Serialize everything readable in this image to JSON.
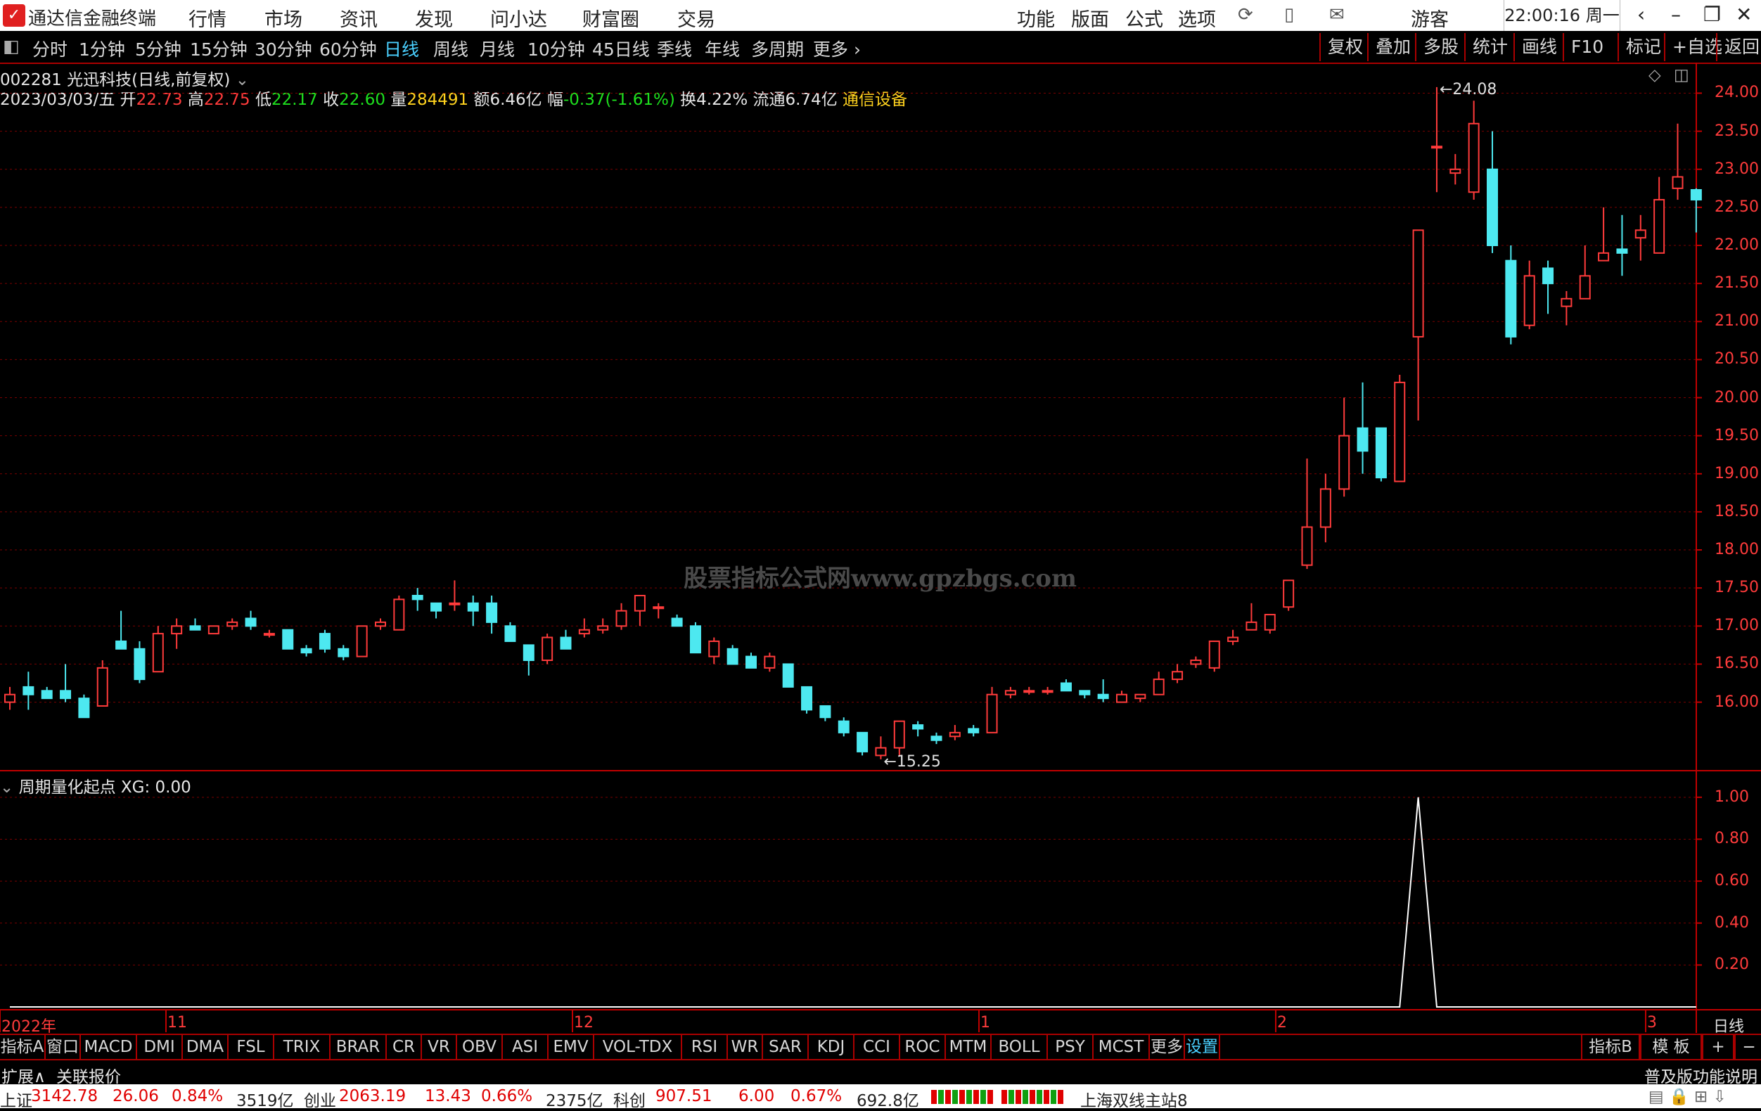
{
  "menubar": {
    "app_title": "通达信金融终端",
    "menus": [
      "行情",
      "市场",
      "资讯",
      "发现",
      "问小达",
      "财富圈",
      "交易"
    ],
    "right_menus": [
      "功能",
      "版面",
      "公式",
      "选项"
    ],
    "user": "游客",
    "clock": "22:00:16 周一"
  },
  "period_bar": {
    "items": [
      "分时",
      "1分钟",
      "5分钟",
      "15分钟",
      "30分钟",
      "60分钟",
      "日线",
      "周线",
      "月线",
      "10分钟",
      "45日线",
      "季线",
      "年线",
      "多周期",
      "更多"
    ],
    "active": "日线",
    "right_items": [
      "复权",
      "叠加",
      "多股",
      "统计",
      "画线",
      "F10",
      "标记",
      "+自选",
      "返回"
    ]
  },
  "stock": {
    "title": "002281 光迅科技(日线,前复权)",
    "date": "2023/03/03/五",
    "open_label": "开",
    "open": "22.73",
    "high_label": "高",
    "high": "22.75",
    "low_label": "低",
    "low": "22.17",
    "close_label": "收",
    "close": "22.60",
    "vol_label": "量",
    "vol": "284491",
    "amount": "额6.46亿",
    "change_label": "幅",
    "change": "-0.37(-1.61%)",
    "turnover": "换4.22%",
    "float_cap": "流通6.74亿",
    "industry": "通信设备"
  },
  "watermark": "股票指标公式网www.gpzbgs.com",
  "indicator": {
    "title": "周期量化起点",
    "value": "XG: 0.00"
  },
  "chart_data": [
    {
      "type": "candlestick",
      "ylim": [
        15.1,
        24.3
      ],
      "yticks": [
        "24.00",
        "23.50",
        "23.00",
        "22.50",
        "22.00",
        "21.50",
        "21.00",
        "20.50",
        "20.00",
        "19.50",
        "19.00",
        "18.50",
        "18.00",
        "17.50",
        "17.00",
        "16.50",
        "16.00"
      ],
      "xticks": [
        "2022年",
        "11",
        "12",
        "1",
        "2",
        "3"
      ],
      "period_label": "日线",
      "max_label": "24.08",
      "min_label": "15.25",
      "candles": [
        [
          16.0,
          16.2,
          16.1,
          15.9
        ],
        [
          16.2,
          16.4,
          16.1,
          15.9
        ],
        [
          16.15,
          16.2,
          16.05,
          16.05
        ],
        [
          16.15,
          16.5,
          16.05,
          16.0
        ],
        [
          16.05,
          16.1,
          15.8,
          15.95
        ],
        [
          15.95,
          16.55,
          16.45,
          15.95
        ],
        [
          16.8,
          17.2,
          16.7,
          16.7
        ],
        [
          16.7,
          16.8,
          16.3,
          16.25
        ],
        [
          16.4,
          17.0,
          16.9,
          16.4
        ],
        [
          16.9,
          17.1,
          17.0,
          16.7
        ],
        [
          17.0,
          17.1,
          16.95,
          16.95
        ],
        [
          16.9,
          17.0,
          17.0,
          16.9
        ],
        [
          17.0,
          17.1,
          17.05,
          16.95
        ],
        [
          17.1,
          17.2,
          17.0,
          16.95
        ],
        [
          16.9,
          16.95,
          16.9,
          16.85
        ],
        [
          16.95,
          16.95,
          16.7,
          16.7
        ],
        [
          16.7,
          16.75,
          16.65,
          16.6
        ],
        [
          16.9,
          16.95,
          16.7,
          16.65
        ],
        [
          16.7,
          16.75,
          16.6,
          16.55
        ],
        [
          16.6,
          17.0,
          17.0,
          16.6
        ],
        [
          17.0,
          17.1,
          17.05,
          16.95
        ],
        [
          16.95,
          17.4,
          17.35,
          16.95
        ],
        [
          17.4,
          17.5,
          17.35,
          17.2
        ],
        [
          17.3,
          17.3,
          17.2,
          17.1
        ],
        [
          17.3,
          17.6,
          17.3,
          17.2
        ],
        [
          17.3,
          17.4,
          17.2,
          17.0
        ],
        [
          17.3,
          17.4,
          17.05,
          16.9
        ],
        [
          17.0,
          17.05,
          16.8,
          16.8
        ],
        [
          16.75,
          16.75,
          16.55,
          16.35
        ],
        [
          16.55,
          16.9,
          16.85,
          16.5
        ],
        [
          16.85,
          16.95,
          16.7,
          16.7
        ],
        [
          16.9,
          17.1,
          16.95,
          16.85
        ],
        [
          16.95,
          17.1,
          17.0,
          16.9
        ],
        [
          17.0,
          17.3,
          17.2,
          16.95
        ],
        [
          17.2,
          17.4,
          17.4,
          17.0
        ],
        [
          17.25,
          17.3,
          17.25,
          17.1
        ],
        [
          17.1,
          17.15,
          17.0,
          17.0
        ],
        [
          17.0,
          17.05,
          16.65,
          16.65
        ],
        [
          16.6,
          16.85,
          16.8,
          16.5
        ],
        [
          16.7,
          16.75,
          16.5,
          16.5
        ],
        [
          16.6,
          16.65,
          16.45,
          16.45
        ],
        [
          16.45,
          16.65,
          16.6,
          16.4
        ],
        [
          16.5,
          16.5,
          16.2,
          16.2
        ],
        [
          16.2,
          16.2,
          15.9,
          15.85
        ],
        [
          15.95,
          15.95,
          15.8,
          15.75
        ],
        [
          15.75,
          15.8,
          15.6,
          15.55
        ],
        [
          15.6,
          15.6,
          15.35,
          15.3
        ],
        [
          15.3,
          15.55,
          15.4,
          15.25
        ],
        [
          15.4,
          15.75,
          15.75,
          15.3
        ],
        [
          15.7,
          15.75,
          15.65,
          15.55
        ],
        [
          15.55,
          15.6,
          15.5,
          15.45
        ],
        [
          15.55,
          15.7,
          15.6,
          15.5
        ],
        [
          15.65,
          15.7,
          15.6,
          15.55
        ],
        [
          15.6,
          16.2,
          16.1,
          15.6
        ],
        [
          16.1,
          16.2,
          16.15,
          16.05
        ],
        [
          16.15,
          16.2,
          16.15,
          16.1
        ],
        [
          16.15,
          16.2,
          16.15,
          16.1
        ],
        [
          16.25,
          16.3,
          16.15,
          16.15
        ],
        [
          16.15,
          16.15,
          16.1,
          16.05
        ],
        [
          16.1,
          16.3,
          16.05,
          16.0
        ],
        [
          16.0,
          16.15,
          16.1,
          16.0
        ],
        [
          16.05,
          16.1,
          16.1,
          16.0
        ],
        [
          16.1,
          16.4,
          16.3,
          16.1
        ],
        [
          16.3,
          16.5,
          16.4,
          16.25
        ],
        [
          16.5,
          16.6,
          16.55,
          16.45
        ],
        [
          16.45,
          16.8,
          16.8,
          16.4
        ],
        [
          16.8,
          16.95,
          16.85,
          16.75
        ],
        [
          16.95,
          17.3,
          17.05,
          16.95
        ],
        [
          16.95,
          17.1,
          17.15,
          16.9
        ],
        [
          17.25,
          17.6,
          17.6,
          17.2
        ],
        [
          17.8,
          19.2,
          18.3,
          17.75
        ],
        [
          18.3,
          19.0,
          18.8,
          18.1
        ],
        [
          18.8,
          20.0,
          19.5,
          18.7
        ],
        [
          19.6,
          20.2,
          19.3,
          19.0
        ],
        [
          19.6,
          19.6,
          18.95,
          18.9
        ],
        [
          18.9,
          20.3,
          20.2,
          18.9
        ],
        [
          20.8,
          22.2,
          22.2,
          19.7
        ],
        [
          23.3,
          24.08,
          23.3,
          22.7
        ],
        [
          22.95,
          23.2,
          23.0,
          22.8
        ],
        [
          22.7,
          23.9,
          23.6,
          22.6
        ],
        [
          23.0,
          23.5,
          22.0,
          21.9
        ],
        [
          21.8,
          22.0,
          20.8,
          20.7
        ],
        [
          20.95,
          21.8,
          21.6,
          20.9
        ],
        [
          21.7,
          21.8,
          21.5,
          21.1
        ],
        [
          21.2,
          21.4,
          21.3,
          20.95
        ],
        [
          21.3,
          22.0,
          21.6,
          21.3
        ],
        [
          21.8,
          22.5,
          21.9,
          21.8
        ],
        [
          21.95,
          22.4,
          21.9,
          21.6
        ],
        [
          22.1,
          22.4,
          22.2,
          21.8
        ],
        [
          21.9,
          22.9,
          22.6,
          21.9
        ],
        [
          22.75,
          23.6,
          22.9,
          22.6
        ],
        [
          22.73,
          22.75,
          22.6,
          22.17
        ]
      ]
    },
    {
      "type": "line",
      "name": "XG",
      "ylim": [
        0,
        1.1
      ],
      "yticks": [
        "1.00",
        "0.80",
        "0.60",
        "0.40",
        "0.20"
      ],
      "peak_index": 76,
      "values_note": "0 everywhere except peak_index"
    }
  ],
  "tabs": [
    "指标A",
    "窗口",
    "MACD",
    "DMI",
    "DMA",
    "FSL",
    "TRIX",
    "BRAR",
    "CR",
    "VR",
    "OBV",
    "ASI",
    "EMV",
    "VOL-TDX",
    "RSI",
    "WR",
    "SAR",
    "KDJ",
    "CCI",
    "ROC",
    "MTM",
    "BOLL",
    "PSY",
    "MCST",
    "更多",
    "设置"
  ],
  "tabs_right": [
    "指标B",
    "模 板",
    "+",
    "−"
  ],
  "extra_bar": {
    "left1": "扩展∧",
    "left2": "关联报价",
    "right": "普及版功能说明"
  },
  "status_bar": {
    "sh_label": "上证",
    "sh_val": "3142.78",
    "sh_chg": "26.06",
    "sh_pct": "0.84%",
    "sh_amt": "3519亿",
    "cy_label": "创业",
    "cy_val": "2063.19",
    "cy_chg": "13.43",
    "cy_pct": "0.66%",
    "cy_amt": "2375亿",
    "kc_label": "科创",
    "kc_val": "907.51",
    "kc_chg": "6.00",
    "kc_pct": "0.67%",
    "kc_amt": "692.8亿",
    "server": "上海双线主站8"
  },
  "colors": {
    "up": "#ff3b3b",
    "down": "#4de8f0",
    "grid": "#7a0000",
    "axis": "#c00000"
  }
}
